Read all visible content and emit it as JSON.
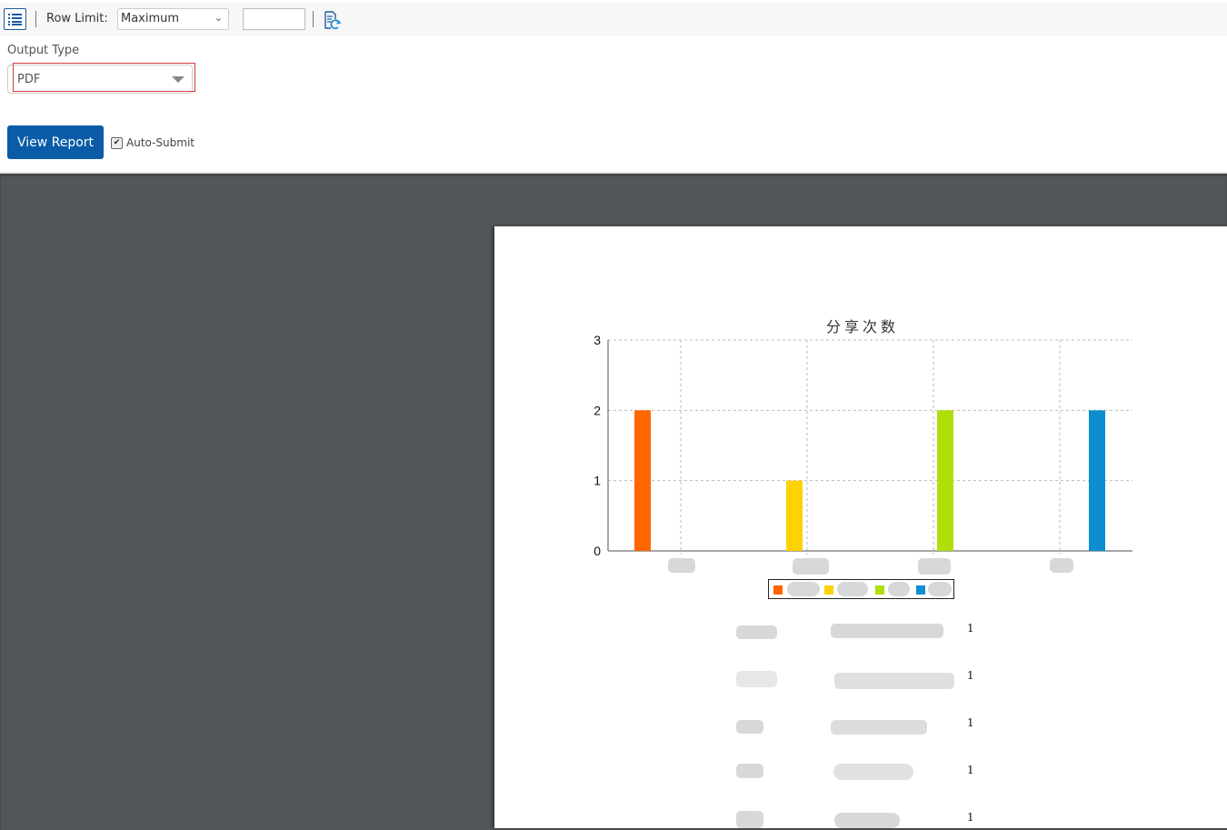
{
  "toolbar": {
    "toc_icon": "list-icon",
    "row_limit_label": "Row Limit:",
    "row_limit_value": "Maximum",
    "row_limit_input_value": "",
    "refresh_icon": "document-refresh-icon"
  },
  "params": {
    "output_type_label": "Output Type",
    "output_type_value": "PDF",
    "view_report_label": "View Report",
    "auto_submit_label": "Auto-Submit",
    "auto_submit_checked": true
  },
  "colors": {
    "accent": "#0a5ca8",
    "viewer_bg": "#535659",
    "highlight": "#d9393b"
  },
  "report": {
    "table_rows": [
      {
        "count": "1"
      },
      {
        "count": "1"
      },
      {
        "count": "1"
      },
      {
        "count": "1"
      },
      {
        "count": "1"
      }
    ]
  },
  "chart_data": {
    "type": "bar",
    "title": "分享次数",
    "categories": [
      "[redacted]",
      "[redacted]",
      "[redacted]",
      "[redacted]"
    ],
    "series": [
      {
        "name": "[redacted]",
        "color": "#ff6600",
        "values": [
          2,
          0,
          0,
          0
        ]
      },
      {
        "name": "[redacted]",
        "color": "#fcd202",
        "values": [
          0,
          1,
          0,
          0
        ]
      },
      {
        "name": "[redacted]",
        "color": "#b0de09",
        "values": [
          0,
          0,
          2,
          0
        ]
      },
      {
        "name": "[redacted]",
        "color": "#0d8ecf",
        "values": [
          0,
          0,
          0,
          2
        ]
      }
    ],
    "bars": [
      {
        "series": 0,
        "value": 2
      },
      {
        "series": 1,
        "value": 1
      },
      {
        "series": 2,
        "value": 2
      },
      {
        "series": 3,
        "value": 2
      }
    ],
    "yticks": [
      "0",
      "1",
      "2",
      "3"
    ],
    "ylim": [
      0,
      3
    ],
    "xlabel": "",
    "ylabel": "",
    "grid": true,
    "legend": "bottom-center"
  }
}
